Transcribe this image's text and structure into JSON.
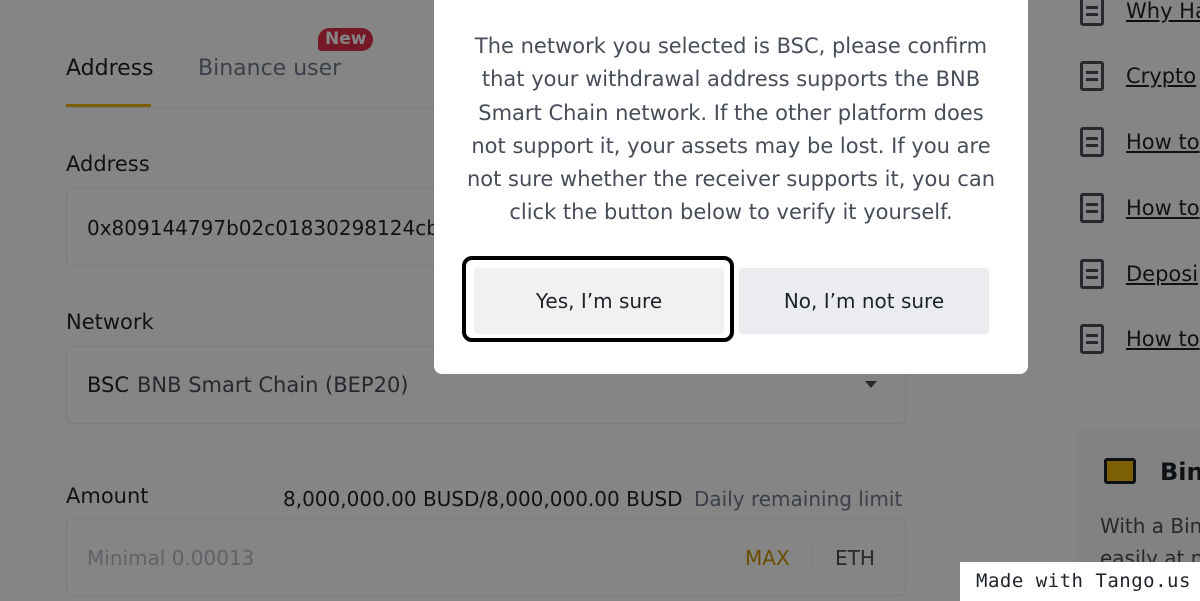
{
  "tabs": {
    "address_label": "Address",
    "binance_user_label": "Binance user",
    "new_badge": "New"
  },
  "form": {
    "address_label": "Address",
    "address_value": "0x809144797b02c01830298124cb...",
    "network_label": "Network",
    "network_code": "BSC",
    "network_name": "BNB Smart Chain (BEP20)",
    "amount_label": "Amount",
    "limit_value": "8,000,000.00 BUSD/8,000,000.00 BUSD",
    "limit_text": "Daily remaining limit",
    "amount_placeholder": "Minimal 0.00013",
    "max_label": "MAX",
    "unit": "ETH"
  },
  "faq": {
    "items": [
      {
        "label": "Why Ha"
      },
      {
        "label": "Crypto"
      },
      {
        "label": "How to"
      },
      {
        "label": "How to"
      },
      {
        "label": "Deposi"
      },
      {
        "label": "How to"
      }
    ]
  },
  "promo": {
    "title": "Bin",
    "line1": "With a Bin",
    "line2": "easily at n"
  },
  "modal": {
    "message": "The network you selected is BSC, please confirm that your withdrawal address supports the BNB Smart Chain network. If the other platform does not support it, your assets may be lost. If you are not sure whether the receiver supports it, you can click the button below to verify it yourself.",
    "yes_label": "Yes, I’m sure",
    "no_label": "No, I’m not sure"
  },
  "watermark": "Made with Tango.us",
  "colors": {
    "accent": "#f0b90b",
    "badge": "#e02e4a",
    "max": "#c99400"
  }
}
